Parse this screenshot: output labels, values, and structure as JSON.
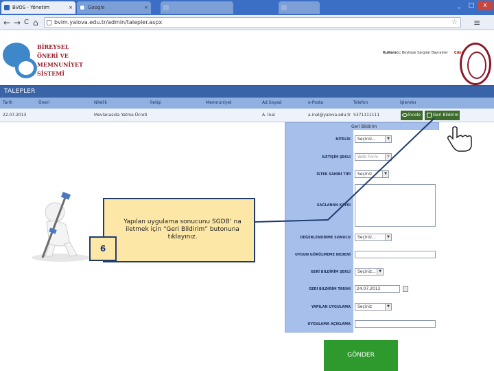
{
  "browser": {
    "tabs": [
      {
        "label": "BVOS - Yönetim",
        "active": true
      },
      {
        "label": "Google",
        "active": false
      },
      {
        "label": "",
        "active": false
      },
      {
        "label": "",
        "active": false
      }
    ],
    "window_controls": [
      "_",
      "□",
      "x"
    ],
    "nav": {
      "back": "←",
      "forward": "→",
      "reload": "C",
      "home": "⌂"
    },
    "address": "bvim.yalova.edu.tr/admin/talepler.aspx"
  },
  "site": {
    "logo_lines": [
      "BİREYSEL",
      "ÖNERİ VE",
      "MEMNUNİYET",
      "SİSTEMİ"
    ],
    "user_label": "Kullanıcı:",
    "user_name": "Beytepe Sargılar Bayraklar",
    "logout": "Çıkış"
  },
  "page": {
    "title": "TALEPLER"
  },
  "grid": {
    "headers": [
      "Tarih",
      "Öneri",
      "Nitelik",
      "İletişi",
      "Memnuniyet",
      "Ad Soyad",
      "e-Posta",
      "Telefon",
      "İşlemler"
    ],
    "row": [
      "22.07.2013",
      "",
      "Mevlanasıda Yatma Ücreti",
      "",
      "",
      "A. İnal",
      "a.inal@yalova.edu.tr",
      "5371111111",
      ""
    ],
    "incele_label": "İncele",
    "geri_label": "Geri Bildirim"
  },
  "form": {
    "title": "Geri Bildirim",
    "labels": {
      "nitelik": "NİTELİK",
      "iletisim": "İLETİŞİM ŞEKLİ",
      "istek": "İSTEK SAHİBİ TİPİ",
      "saglanan": "SAĞLANAN KATKI",
      "degerlendirme": "DEĞERLENDİRME SONUCU",
      "uygun_gorulmeme": "UYGUN GÖRÜLMEME NEDENİ",
      "geri_bildirim_sekli": "GERİ BİLDİRİM ŞEKLİ",
      "geri_bildirim_tarihi": "GERİ BİLDİRİM TARİHİ",
      "yapilan_uygulama": "YAPILAN UYGULAMA",
      "uygulama_aciklama": "UYGULAMA AÇIKLAMA"
    },
    "values": {
      "nitelik": "Seçiniz...",
      "iletisim": "Web Form",
      "istek": "Seçiniz",
      "degerlendirme": "Seçiniz...",
      "geri_bildirim_sekli": "Seçiniz...",
      "geri_bildirim_tarihi": "24.07.2013",
      "yapilan_uygulama": "Seçiniz"
    },
    "dropdown_glyph": "▼",
    "submit": "GÖNDER"
  },
  "callout": {
    "text": "Yapılan uygulama sonucunu SGDB’ na iletmek için “Geri Bildirim” butonuna tıklayınız.",
    "step": "6"
  },
  "colors": {
    "title_bar": "#3a64a8",
    "grid_header": "#8fb0e0",
    "panel": "#a7bfeb",
    "button_green": "#3d6c2c",
    "submit_green": "#2e9a2e",
    "callout_fill": "#fde7a6",
    "brand_red": "#9a1c2b"
  },
  "icons": [
    "favicon-icon",
    "google-icon",
    "document-icon",
    "star-icon",
    "wrench-icon",
    "eye-icon",
    "edit-icon",
    "calendar-icon",
    "pointer-hand-icon",
    "university-seal-icon"
  ]
}
